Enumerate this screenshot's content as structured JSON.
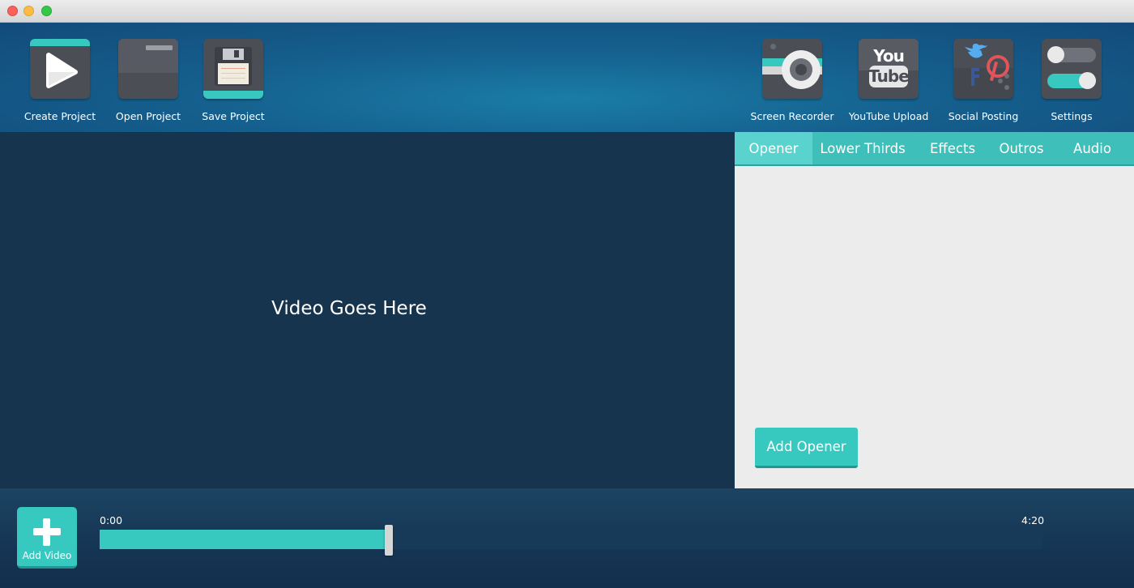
{
  "toolbar": {
    "left_tools": [
      {
        "label": "Create Project",
        "icon": "play-icon"
      },
      {
        "label": "Open Project",
        "icon": "folder-icon"
      },
      {
        "label": "Save Project",
        "icon": "floppy-disk-icon"
      }
    ],
    "right_tools": [
      {
        "label": "Screen Recorder",
        "icon": "camera-icon"
      },
      {
        "label": "YouTube Upload",
        "icon": "youtube-icon",
        "logo_text_top": "You",
        "logo_text_bottom": "Tube"
      },
      {
        "label": "Social Posting",
        "icon": "social-icon"
      },
      {
        "label": "Settings",
        "icon": "toggle-switches-icon"
      }
    ]
  },
  "preview": {
    "placeholder": "Video Goes Here"
  },
  "panel": {
    "tabs": [
      "Opener",
      "Lower Thirds",
      "Effects",
      "Outros",
      "Audio"
    ],
    "active_tab": "Opener",
    "action_button": "Add Opener"
  },
  "timeline": {
    "add_video_label": "Add Video",
    "start_time": "0:00",
    "end_time": "4:20",
    "progress_fraction": 0.307
  },
  "colors": {
    "accent": "#37c8bf",
    "toolbar_blue": "#15608e",
    "preview_bg": "#17344f",
    "panel_bg": "#ececec",
    "icon_bg": "#4b4e55"
  }
}
